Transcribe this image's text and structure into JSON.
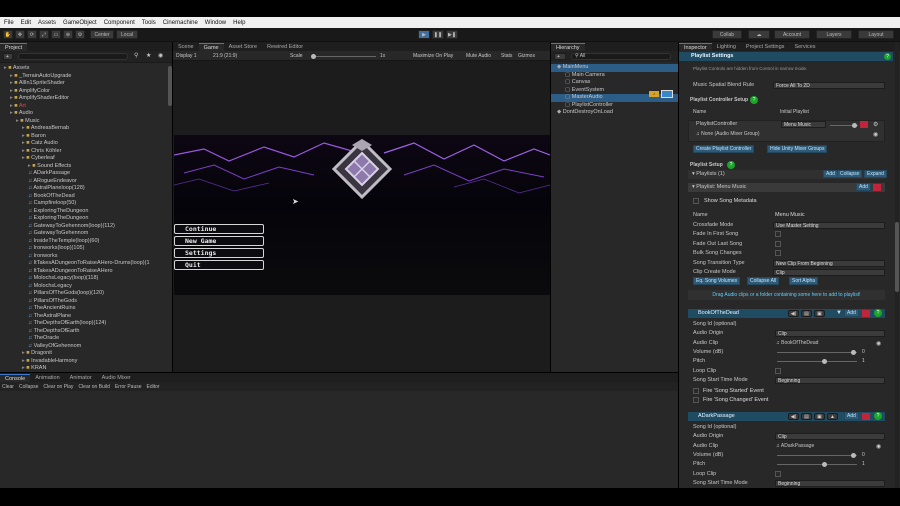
{
  "menu": [
    "File",
    "Edit",
    "Assets",
    "GameObject",
    "Component",
    "Tools",
    "Cinemachine",
    "Window",
    "Help"
  ],
  "toolbar": {
    "center": "Center",
    "local": "Local",
    "collab": "Collab",
    "account": "Account",
    "layers": "Layers",
    "layout": "Layout"
  },
  "project": {
    "tab": "Project",
    "items": [
      {
        "t": "Assets",
        "i": 0,
        "k": "f"
      },
      {
        "t": "_TerrainAutoUpgrade",
        "i": 1,
        "k": "f"
      },
      {
        "t": "AllIn1SpriteShader",
        "i": 1,
        "k": "f"
      },
      {
        "t": "AmplifyColor",
        "i": 1,
        "k": "f"
      },
      {
        "t": "AmplifyShaderEditor",
        "i": 1,
        "k": "f"
      },
      {
        "t": "Art",
        "i": 1,
        "k": "f"
      },
      {
        "t": "Audio",
        "i": 1,
        "k": "f"
      },
      {
        "t": "Music",
        "i": 2,
        "k": "f"
      },
      {
        "t": "AndreasBernab",
        "i": 3,
        "k": "f"
      },
      {
        "t": "Baron",
        "i": 3,
        "k": "f"
      },
      {
        "t": "Catz Audio",
        "i": 3,
        "k": "f"
      },
      {
        "t": "Chris Köhler",
        "i": 3,
        "k": "f"
      },
      {
        "t": "Cyberleaf",
        "i": 3,
        "k": "f"
      },
      {
        "t": "Sound Effects",
        "i": 4,
        "k": "f"
      },
      {
        "t": "ADarkPassage",
        "i": 4,
        "k": "a"
      },
      {
        "t": "ARogueEndeavor",
        "i": 4,
        "k": "a"
      },
      {
        "t": "AstralPlaneloop(128)",
        "i": 4,
        "k": "a"
      },
      {
        "t": "BookOfTheDead",
        "i": 4,
        "k": "a"
      },
      {
        "t": "Campfireloop(50)",
        "i": 4,
        "k": "a"
      },
      {
        "t": "ExploringTheDungeon",
        "i": 4,
        "k": "a"
      },
      {
        "t": "ExploringTheDungeon",
        "i": 4,
        "k": "a"
      },
      {
        "t": "GatewayToGehennom(loop)(112)",
        "i": 4,
        "k": "a"
      },
      {
        "t": "GatewayToGehennom",
        "i": 4,
        "k": "a"
      },
      {
        "t": "InsideTheTemple(loop)(60)",
        "i": 4,
        "k": "a"
      },
      {
        "t": "Ironworks(loop)(105)",
        "i": 4,
        "k": "a"
      },
      {
        "t": "Ironworks",
        "i": 4,
        "k": "a"
      },
      {
        "t": "ItTakesADungeonToRaiseAHero-Drums(loop)(1",
        "i": 4,
        "k": "a"
      },
      {
        "t": "ItTakesADungeonToRaiseAHero",
        "i": 4,
        "k": "a"
      },
      {
        "t": "MolochsLegacy(loop)(118)",
        "i": 4,
        "k": "a"
      },
      {
        "t": "MolochsLegacy",
        "i": 4,
        "k": "a"
      },
      {
        "t": "PillarsOfTheGods(loop)(120)",
        "i": 4,
        "k": "a"
      },
      {
        "t": "PillarsOfTheGods",
        "i": 4,
        "k": "a"
      },
      {
        "t": "TheAncientRuins",
        "i": 4,
        "k": "a"
      },
      {
        "t": "TheAstralPlane",
        "i": 4,
        "k": "a"
      },
      {
        "t": "TheDepthsOfEarth(loop)(124)",
        "i": 4,
        "k": "a"
      },
      {
        "t": "TheDepthsOfEarth",
        "i": 4,
        "k": "a"
      },
      {
        "t": "TheOracle",
        "i": 4,
        "k": "a"
      },
      {
        "t": "ValleyOfGehennom",
        "i": 4,
        "k": "a"
      },
      {
        "t": "Dragonit",
        "i": 3,
        "k": "f"
      },
      {
        "t": "InvadableHarmony",
        "i": 3,
        "k": "f"
      },
      {
        "t": "KRAN",
        "i": 3,
        "k": "f"
      }
    ]
  },
  "game": {
    "tabs": [
      "Scene",
      "Game",
      "Asset Store",
      "Rewired Editor"
    ],
    "display": "Display 1",
    "aspect": "21:9 (21:9)",
    "scale_label": "Scale",
    "scale_value": "1x",
    "opts": [
      "Maximize On Play",
      "Mute Audio",
      "Stats",
      "Gizmos"
    ],
    "menu": [
      "Continue",
      "New Game",
      "Settings",
      "Quit"
    ]
  },
  "hierarchy": {
    "tab": "Hierarchy",
    "search": "All",
    "items": [
      {
        "t": "MainMenu",
        "i": 0,
        "sel": true
      },
      {
        "t": "Main Camera",
        "i": 1
      },
      {
        "t": "Canvas",
        "i": 1
      },
      {
        "t": "EventSystem",
        "i": 1
      },
      {
        "t": "MasterAudio",
        "i": 1,
        "sel": true
      },
      {
        "t": "PlaylistController",
        "i": 1
      },
      {
        "t": "DontDestroyOnLoad",
        "i": 0
      }
    ]
  },
  "inspector": {
    "tabs": [
      "Inspector",
      "Lighting",
      "Project Settings",
      "Services"
    ],
    "header": "Playlist Settings",
    "hint": "Playlist Controls are hidden from Control in narrow mode.",
    "blend_label": "Music Spatial Blend Rule",
    "blend_value": "Force All To 2D",
    "pc_setup": "Playlist Controller Setup",
    "col_name": "Name",
    "col_initial": "Initial Playlist",
    "pc_name": "PlaylistController",
    "pc_playlist": "Menu Music",
    "pc_mixer": "None (Audio Mixer Group)",
    "btn_create": "Create Playlist Controller",
    "btn_hide": "Hide Unity Mixer Groups",
    "playlist_setup": "Playlist Setup",
    "playlists": "Playlists (1)",
    "add": "Add",
    "collapse": "Collapse",
    "expand": "Expand",
    "playlist_title": "Playlist: Menu Music",
    "show_meta": "Show Song Metadata",
    "fields": [
      {
        "l": "Name",
        "v": "Menu Music"
      },
      {
        "l": "Crossfade Mode",
        "v": "Use Master Setting",
        "dd": true
      },
      {
        "l": "Fade In First Song",
        "v": ""
      },
      {
        "l": "Fade Out Last Song",
        "v": ""
      },
      {
        "l": "Bulk Song Changes",
        "v": ""
      },
      {
        "l": "Song Transition Type",
        "v": "New Clip From Beginning",
        "dd": true
      },
      {
        "l": "Clip Create Mode",
        "v": "Clip",
        "dd": true
      }
    ],
    "eq_btns": [
      "Eq. Song Volumes",
      "Collapse All",
      "Sort Alpha"
    ],
    "drag_hint": "Drag Audio clips or a folder containing some here to add to playlist!",
    "songs": [
      {
        "title": "BookOfTheDead",
        "id_label": "Song Id (optional)",
        "origin": "Clip",
        "clip": "BookOfTheDead",
        "volume": "0",
        "pitch": "1"
      },
      {
        "title": "ADarkPassage",
        "id_label": "Song Id (optional)",
        "origin": "Clip",
        "clip": "ADarkPassage",
        "volume": "0",
        "pitch": "1"
      }
    ],
    "song_labels": {
      "origin": "Audio Origin",
      "clip": "Audio Clip",
      "volume": "Volume (dB)",
      "pitch": "Pitch",
      "loop": "Loop Clip",
      "start": "Song Start Time Mode",
      "start_v": "Beginning",
      "ev1": "Fire 'Song Started' Event",
      "ev2": "Fire 'Song Changed' Event",
      "add": "Add"
    }
  },
  "console": {
    "tabs": [
      "Console",
      "Animation",
      "Animator",
      "Audio Mixer"
    ],
    "opts": [
      "Clear",
      "Collapse",
      "Clear on Play",
      "Clear on Build",
      "Error Pause",
      "Editor"
    ]
  }
}
